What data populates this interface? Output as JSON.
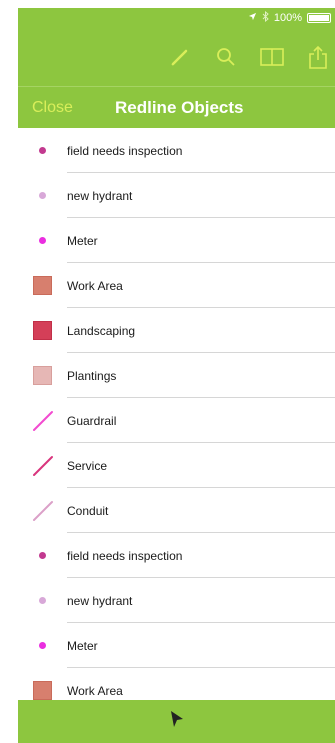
{
  "status_bar": {
    "battery_text": "100%"
  },
  "toolbar": {
    "icons": [
      "pencil-icon",
      "search-icon",
      "book-icon",
      "share-icon"
    ]
  },
  "nav": {
    "close_label": "Close",
    "title": "Redline Objects"
  },
  "colors": {
    "accent_green": "#8dc63f",
    "close_yellow": "#d9ee5a"
  },
  "items": [
    {
      "label": "field needs inspection",
      "symbol": "dot",
      "color": "#c2398f"
    },
    {
      "label": "new hydrant",
      "symbol": "dot",
      "color": "#d8a8d8"
    },
    {
      "label": "Meter",
      "symbol": "dot",
      "color": "#ea2ee0"
    },
    {
      "label": "Work Area",
      "symbol": "square",
      "color": "#d77f6e",
      "border": "#c96b5a"
    },
    {
      "label": "Landscaping",
      "symbol": "square",
      "color": "#d43f58",
      "border": "#c12f48"
    },
    {
      "label": "Plantings",
      "symbol": "square",
      "color": "#e6b7b5",
      "border": "#d89f9c"
    },
    {
      "label": "Guardrail",
      "symbol": "line",
      "color": "#f24bd0"
    },
    {
      "label": "Service",
      "symbol": "line",
      "color": "#d9357d"
    },
    {
      "label": "Conduit",
      "symbol": "line",
      "color": "#dba0c8"
    },
    {
      "label": "field needs inspection",
      "symbol": "dot",
      "color": "#c2398f"
    },
    {
      "label": "new hydrant",
      "symbol": "dot",
      "color": "#d8a8d8"
    },
    {
      "label": "Meter",
      "symbol": "dot",
      "color": "#ea2ee0"
    },
    {
      "label": "Work Area",
      "symbol": "square",
      "color": "#d77f6e",
      "border": "#c96b5a"
    }
  ],
  "bottom_bar": {
    "icon": "cursor-arrow-icon"
  }
}
